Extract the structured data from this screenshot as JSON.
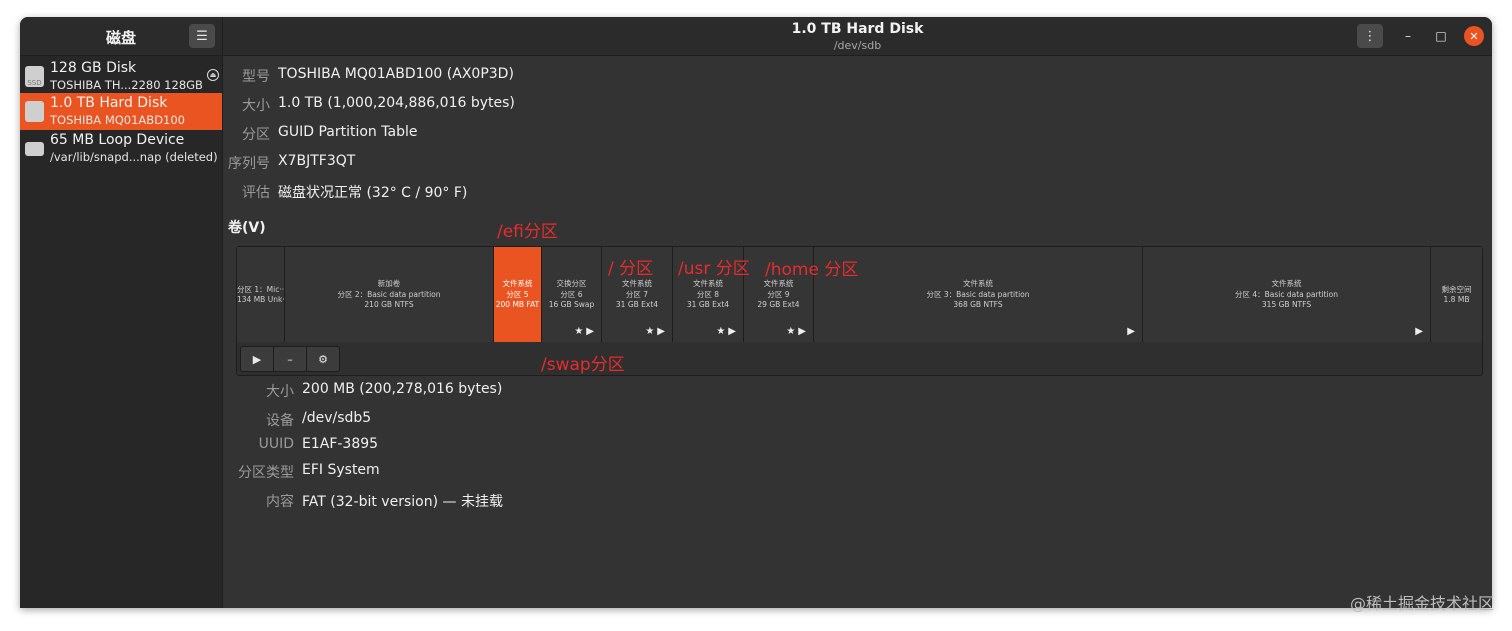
{
  "app": {
    "title": "磁盘",
    "menu_icon": "hamburger-icon"
  },
  "header": {
    "title": "1.0 TB Hard Disk",
    "subtitle": "/dev/sdb"
  },
  "drives": [
    {
      "name": "128 GB Disk",
      "desc": "TOSHIBA TH...2280 128GB",
      "icon_label": "SSD"
    },
    {
      "name": "1.0 TB Hard Disk",
      "desc": "TOSHIBA MQ01ABD100",
      "icon_label": ""
    },
    {
      "name": "65 MB Loop Device",
      "desc": "/var/lib/snapd...nap (deleted)",
      "icon_label": ""
    }
  ],
  "disk_info": [
    {
      "label": "型号",
      "value": "TOSHIBA MQ01ABD100 (AX0P3D)"
    },
    {
      "label": "大小",
      "value": "1.0 TB (1,000,204,886,016 bytes)"
    },
    {
      "label": "分区",
      "value": "GUID Partition Table"
    },
    {
      "label": "序列号",
      "value": "X7BJTF3QT"
    },
    {
      "label": "评估",
      "value": "磁盘状况正常 (32° C / 90° F)"
    }
  ],
  "volumes": {
    "heading": "卷(V)",
    "segments": [
      {
        "l1": "",
        "l2": "分区 1：Mic···",
        "l3": "134 MB Unk···",
        "icons": ""
      },
      {
        "l1": "新加卷",
        "l2": "分区 2：Basic data partition",
        "l3": "210 GB NTFS",
        "icons": ""
      },
      {
        "l1": "文件系统",
        "l2": "分区 5",
        "l3": "200 MB FAT",
        "icons": ""
      },
      {
        "l1": "交换分区",
        "l2": "分区 6",
        "l3": "16 GB Swap",
        "icons": "★▶"
      },
      {
        "l1": "文件系统",
        "l2": "分区 7",
        "l3": "31 GB Ext4",
        "icons": "★▶"
      },
      {
        "l1": "文件系统",
        "l2": "分区 8",
        "l3": "31 GB Ext4",
        "icons": "★▶"
      },
      {
        "l1": "文件系统",
        "l2": "分区 9",
        "l3": "29 GB Ext4",
        "icons": "★▶"
      },
      {
        "l1": "文件系统",
        "l2": "分区 3：Basic data partition",
        "l3": "368 GB NTFS",
        "icons": "▶"
      },
      {
        "l1": "文件系统",
        "l2": "分区 4：Basic data partition",
        "l3": "315 GB NTFS",
        "icons": "▶"
      },
      {
        "l1": "剩余空间",
        "l2": "1.8 MB",
        "l3": "",
        "icons": ""
      }
    ],
    "toolbar": {
      "play": "▶",
      "minus": "–",
      "settings": "⚙"
    }
  },
  "partition_info": [
    {
      "label": "大小",
      "value": "200 MB (200,278,016 bytes)"
    },
    {
      "label": "设备",
      "value": "/dev/sdb5"
    },
    {
      "label": "UUID",
      "value": "E1AF-3895"
    },
    {
      "label": "分区类型",
      "value": "EFI System"
    },
    {
      "label": "内容",
      "value": "FAT (32-bit version) — 未挂载"
    }
  ],
  "annotations": {
    "efi": "/efi分区",
    "root": "/ 分区",
    "usr": "/usr 分区",
    "home": "/home 分区",
    "swap": "/swap分区"
  },
  "watermark": "@稀土掘金技术社区",
  "colors": {
    "accent": "#e95420",
    "annotation": "#e62c2c",
    "bg": "#333333"
  }
}
